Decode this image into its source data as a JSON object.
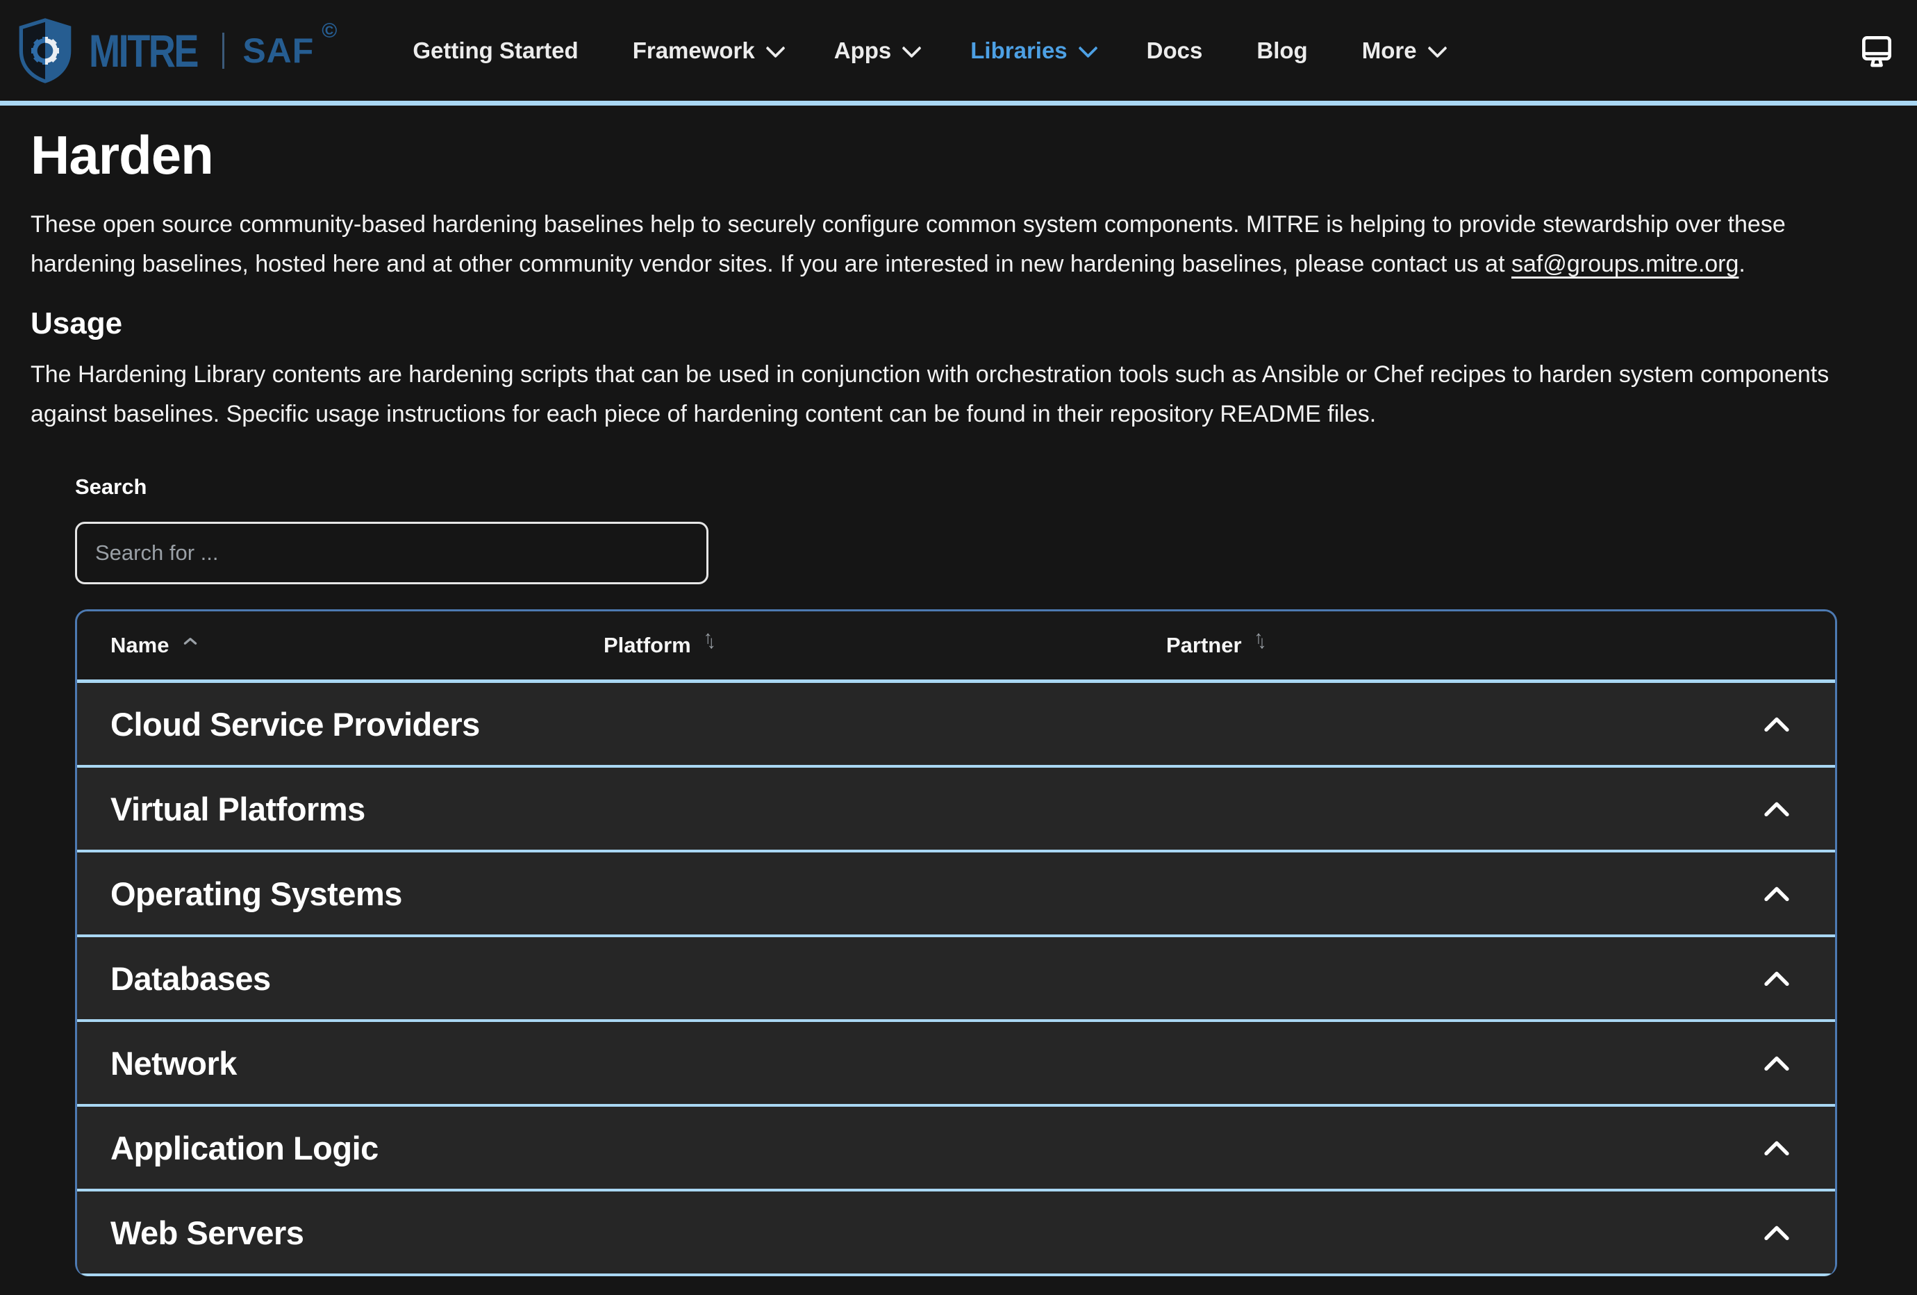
{
  "nav": {
    "brand": {
      "mitre": "MITRE",
      "saf": "SAF",
      "copyright": "©"
    },
    "items": [
      {
        "label": "Getting Started"
      },
      {
        "label": "Framework"
      },
      {
        "label": "Apps"
      },
      {
        "label": "Libraries"
      },
      {
        "label": "Docs"
      },
      {
        "label": "Blog"
      },
      {
        "label": "More"
      }
    ]
  },
  "page": {
    "title": "Harden",
    "intro_pre": "These open source community-based hardening baselines help to securely configure common system components. MITRE is helping to provide stewardship over these hardening baselines, hosted here and at other community vendor sites. If you are interested in new hardening baselines, please contact us at ",
    "intro_link": "saf@groups.mitre.org",
    "intro_post": ".",
    "usage_heading": "Usage",
    "usage_text": "The Hardening Library contents are hardening scripts that can be used in conjunction with orchestration tools such as Ansible or Chef recipes to harden system components against baselines. Specific usage instructions for each piece of hardening content can be found in their repository README files."
  },
  "search": {
    "label": "Search",
    "placeholder": "Search for ...",
    "value": ""
  },
  "table": {
    "columns": [
      {
        "label": "Name",
        "sort": "asc"
      },
      {
        "label": "Platform",
        "sort": "none"
      },
      {
        "label": "Partner",
        "sort": "none"
      }
    ],
    "sections": [
      {
        "label": "Cloud Service Providers",
        "expanded": true
      },
      {
        "label": "Virtual Platforms",
        "expanded": true
      },
      {
        "label": "Operating Systems",
        "expanded": true
      },
      {
        "label": "Databases",
        "expanded": true
      },
      {
        "label": "Network",
        "expanded": true
      },
      {
        "label": "Application Logic",
        "expanded": true
      },
      {
        "label": "Web Servers",
        "expanded": true
      }
    ]
  },
  "colors": {
    "accent_light_blue": "#a9d7f3",
    "nav_active_blue": "#4da0e4",
    "brand_blue": "#265d91",
    "table_border_blue": "#4d7ab2",
    "row_background": "#262626",
    "page_background": "#151515"
  }
}
